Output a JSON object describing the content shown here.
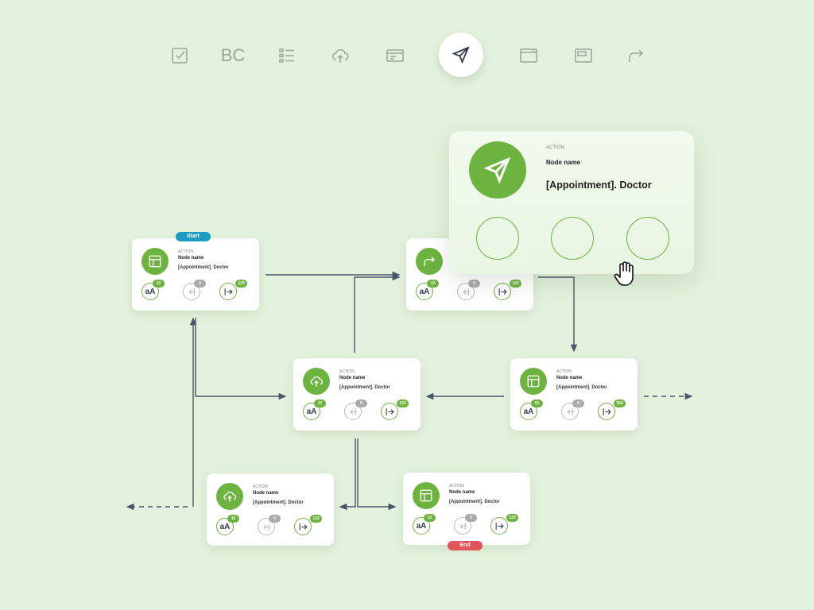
{
  "toolbar": {
    "items": [
      {
        "icon": "checkbox-icon"
      },
      {
        "label": "BC"
      },
      {
        "icon": "checklist-icon"
      },
      {
        "icon": "cloud-upload-icon"
      },
      {
        "icon": "form-icon"
      },
      {
        "icon": "send-icon",
        "active": true
      },
      {
        "icon": "browser-window-icon"
      },
      {
        "icon": "window-icon"
      },
      {
        "icon": "forward-arrow-icon"
      }
    ]
  },
  "popup": {
    "kind": "Action",
    "name": "Node name",
    "subtitle": "[Appointment]. Doctor"
  },
  "nodes": [
    {
      "id": "n1",
      "icon": "layout-icon",
      "kind": "Action",
      "name": "Node name",
      "subtitle": "[Appointment]. Doctor",
      "counts": [
        "12",
        "0",
        "123"
      ]
    },
    {
      "id": "n2",
      "icon": "forward-arrow-icon",
      "kind": "",
      "name": "",
      "subtitle": "",
      "counts": [
        "12",
        "0",
        "123"
      ]
    },
    {
      "id": "n3",
      "icon": "cloud-upload-icon",
      "kind": "Action",
      "name": "Node name",
      "subtitle": "[Appointment]. Doctor",
      "counts": [
        "12",
        "0",
        "123"
      ]
    },
    {
      "id": "n4",
      "icon": "layout-icon",
      "kind": "Action",
      "name": "Node name",
      "subtitle": "[Appointment]. Doctor",
      "counts": [
        "52",
        "0",
        "324"
      ]
    },
    {
      "id": "n5",
      "icon": "cloud-upload-icon",
      "kind": "Action",
      "name": "Node name",
      "subtitle": "[Appointment]. Doctor",
      "counts": [
        "12",
        "0",
        "123"
      ]
    },
    {
      "id": "n6",
      "icon": "layout-icon",
      "kind": "Action",
      "name": "Node name",
      "subtitle": "[Appointment]. Doctor",
      "counts": [
        "12",
        "0",
        "123"
      ]
    }
  ],
  "node_button_text": "aA",
  "start_label": "Start",
  "end_label": "End",
  "colors": {
    "background": "#e3f2dc",
    "accent": "#6db33f",
    "start": "#1f9bc2",
    "end": "#e1545b",
    "connector": "#4a5568"
  }
}
